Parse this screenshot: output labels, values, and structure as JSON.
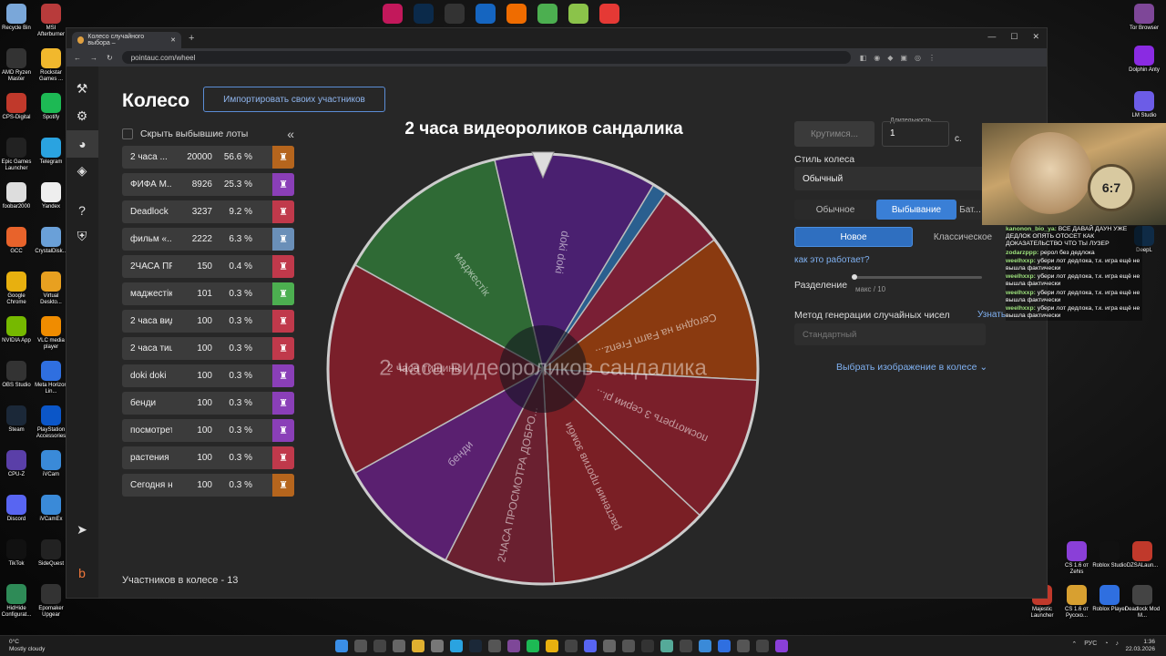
{
  "desktop": {
    "left_icons": [
      {
        "label": "Recycle Bin",
        "color": "#7aa7d9"
      },
      {
        "label": "MSI Afterburner",
        "color": "#b83b3b"
      },
      {
        "label": "AMD Ryzen Master",
        "color": "#333"
      },
      {
        "label": "Rockstar Games ...",
        "color": "#f1b82d"
      },
      {
        "label": "CPS-Digital",
        "color": "#c0392b"
      },
      {
        "label": "Spotify",
        "color": "#1db954"
      },
      {
        "label": "Epic Games Launcher",
        "color": "#222"
      },
      {
        "label": "Telegram",
        "color": "#2aa3e0"
      },
      {
        "label": "foobar2000",
        "color": "#ddd"
      },
      {
        "label": "Yandex",
        "color": "#eee"
      },
      {
        "label": "GCC",
        "color": "#e8632b"
      },
      {
        "label": "CrystalDisk...",
        "color": "#6aa0d8"
      },
      {
        "label": "Google Chrome",
        "color": "#e8b00f"
      },
      {
        "label": "Virtual Deskto...",
        "color": "#e8a020"
      },
      {
        "label": "NVIDIA App",
        "color": "#76b900"
      },
      {
        "label": "VLC media player",
        "color": "#f08c00"
      },
      {
        "label": "OBS Studio",
        "color": "#333"
      },
      {
        "label": "Meta Horizon Lin...",
        "color": "#2f6fe0"
      },
      {
        "label": "Steam",
        "color": "#1b2838"
      },
      {
        "label": "PlayStation Accessories",
        "color": "#0b56c8"
      },
      {
        "label": "CPU-Z",
        "color": "#5a3fa8"
      },
      {
        "label": "iVCam",
        "color": "#3a8ad8"
      },
      {
        "label": "Discord",
        "color": "#5865f2"
      },
      {
        "label": "iVCamEx",
        "color": "#3a8ad8"
      },
      {
        "label": "TikTok",
        "color": "#111"
      },
      {
        "label": "SideQuest",
        "color": "#222"
      },
      {
        "label": "HidHide Configurat...",
        "color": "#2e8b57"
      },
      {
        "label": "Epomaker Upgear",
        "color": "#333"
      }
    ],
    "right_icons": [
      {
        "label": "Tor Browser",
        "color": "#7e4798"
      },
      {
        "label": "Dolphin Anty",
        "color": "#8a2be2"
      },
      {
        "label": "LM Studio",
        "color": "#6c5ce7"
      },
      {
        "label": "DeepL",
        "color": "#0f2b46"
      }
    ],
    "bottom_right_icons": [
      {
        "label": "CS 1.6 от Zehis",
        "color": "#8a3fd8"
      },
      {
        "label": "Roblox Studio",
        "color": "#111"
      },
      {
        "label": "DZSALaun...",
        "color": "#c0392b"
      },
      {
        "label": "Majestic Launcher",
        "color": "#c0392b"
      },
      {
        "label": "CS 1.6 от Русско...",
        "color": "#d8a030"
      },
      {
        "label": "Roblox Player",
        "color": "#2f6fe0"
      },
      {
        "label": "Deadlock Mod M...",
        "color": "#444"
      }
    ]
  },
  "browser": {
    "tab_title": "Колесо случайного выбора –",
    "new_tab_symbol": "+",
    "url": "pointauc.com/wheel",
    "window_controls": [
      "—",
      "☐",
      "✕"
    ]
  },
  "app": {
    "title": "Колесо",
    "import_button": "Импортировать своих участников",
    "hide_lots_label": "Скрыть выбывшие лоты",
    "collapse_symbol": "«",
    "lots": [
      {
        "name": "2 часа ...",
        "amount": "20000",
        "percent": "56.6 %",
        "color": "#b5651d"
      },
      {
        "name": "ФИФА М...",
        "amount": "8926",
        "percent": "25.3 %",
        "color": "#8a3fb8"
      },
      {
        "name": "Deadlock",
        "amount": "3237",
        "percent": "9.2 %",
        "color": "#c0394b"
      },
      {
        "name": "фильм «...",
        "amount": "2222",
        "percent": "6.3 %",
        "color": "#6a8fb8"
      },
      {
        "name": "2ЧАСА ПР...",
        "amount": "150",
        "percent": "0.4 %",
        "color": "#c0394b"
      },
      {
        "name": "маджестік",
        "amount": "101",
        "percent": "0.3 %",
        "color": "#4caf50"
      },
      {
        "name": "2 часа вид...",
        "amount": "100",
        "percent": "0.3 %",
        "color": "#c0394b"
      },
      {
        "name": "2 часа тиш...",
        "amount": "100",
        "percent": "0.3 %",
        "color": "#c0394b"
      },
      {
        "name": "doki doki",
        "amount": "100",
        "percent": "0.3 %",
        "color": "#8a3fb8"
      },
      {
        "name": "бенди",
        "amount": "100",
        "percent": "0.3 %",
        "color": "#8a3fb8"
      },
      {
        "name": "посмотрет...",
        "amount": "100",
        "percent": "0.3 %",
        "color": "#8a3fb8"
      },
      {
        "name": "растения п...",
        "amount": "100",
        "percent": "0.3 %",
        "color": "#c0394b"
      },
      {
        "name": "Сегодня н...",
        "amount": "100",
        "percent": "0.3 %",
        "color": "#b5651d"
      }
    ],
    "participants_count": "Участников в колесе - 13",
    "wheel_title": "2 часа видеороликов сандалика",
    "wheel_center_text": "2 часа видеороликов сандалика",
    "wheel_segments": [
      {
        "label": "2 часа видеороликов с...",
        "color": "#7a1f35"
      },
      {
        "label": "Сегодня на Farm Frenz...",
        "color": "#8a3a10"
      },
      {
        "label": "посмотреть 3 серии рi...",
        "color": "#7a1f2a"
      },
      {
        "label": "растения против зомби",
        "color": "#7a1f25"
      },
      {
        "label": "2ЧАСА ПРОСМОТРА ДОБРО...",
        "color": "#6a2030"
      },
      {
        "label": "бенди",
        "color": "#5a2070"
      },
      {
        "label": "2 часа тишины",
        "color": "#7a1f2a"
      },
      {
        "label": "маджестік",
        "color": "#2f6a35"
      },
      {
        "label": "doki doki",
        "color": "#4a2070"
      },
      {
        "label": "",
        "color": "#2a5f8f"
      }
    ],
    "spin_button": "Крутимся...",
    "duration_label": "Длительность",
    "duration_value": "1",
    "duration_unit": "с.",
    "wheel_style_label": "Стиль колеса",
    "wheel_style_value": "Обычный",
    "mode_tabs": [
      "Обычное",
      "Выбывание",
      "Бат..."
    ],
    "variant_tabs": [
      "Новое",
      "Классическое"
    ],
    "how_it_works": "как это работает?",
    "split_label": "Разделение",
    "split_max": "макс / 10",
    "rng_label": "Метод генерации случайных чисел",
    "rng_more": "Узнать",
    "rng_value": "Стандартный",
    "choose_image": "Выбрать изображение в колесе ⌄"
  },
  "overlay": {
    "clock_text": "6:7",
    "chat": [
      {
        "user": "kanonon_bio_ya:",
        "text": "ВСЕ ДАВАЙ ДАУН УЖЕ ДЕДЛОК ОПЯТЬ ОТОСЕТ КАК ДОКАЗАТЕЛЬСТВО ЧТО ТЫ ЛУЗЕР"
      },
      {
        "user": "zodarzppp:",
        "text": "рерол без дедлока"
      },
      {
        "user": "weelhxxp:",
        "text": "убери лот дедлока, т.к. игра ещё не вышла фактически"
      },
      {
        "user": "weelhxxp:",
        "text": "убери лот дедлока, т.к. игра ещё не вышла фактически"
      },
      {
        "user": "weelhxxp:",
        "text": "убери лот дедлока, т.к. игра ещё не вышла фактически"
      },
      {
        "user": "weelhxxp:",
        "text": "убери лот дедлока, т.к. игра ещё не вышла фактически"
      }
    ]
  },
  "taskbar": {
    "weather_temp": "0°C",
    "weather_desc": "Mostly cloudy",
    "lang": "РУС",
    "time": "1:36",
    "date": "22.03.2026"
  }
}
